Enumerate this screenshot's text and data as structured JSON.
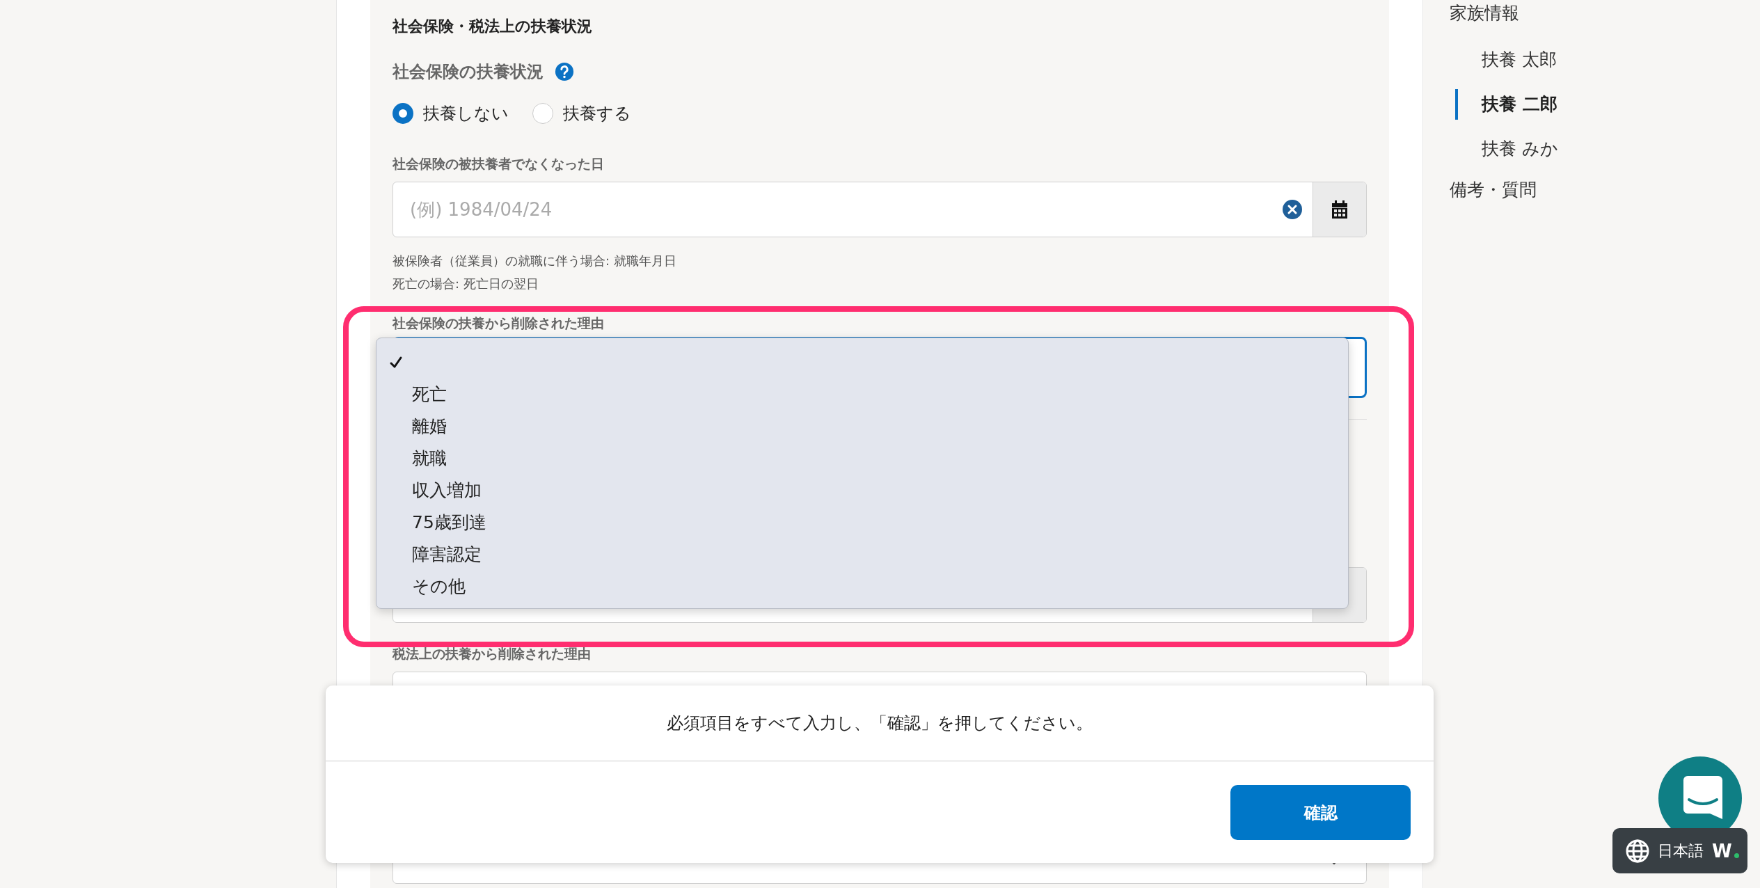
{
  "section_title": "社会保険・税法上の扶養状況",
  "social_insurance": {
    "label": "社会保険の扶養状況",
    "options": [
      {
        "label": "扶養しない",
        "selected": true
      },
      {
        "label": "扶養する",
        "selected": false
      }
    ]
  },
  "loss_date": {
    "label": "社会保険の被扶養者でなくなった日",
    "placeholder": "(例) 1984/04/24",
    "notes": [
      "被保険者（従業員）の就職に伴う場合: 就職年月日",
      "死亡の場合: 死亡日の翌日"
    ]
  },
  "removal_reason": {
    "label": "社会保険の扶養から削除された理由",
    "dropdown": {
      "blank_selected": true,
      "options": [
        {
          "label": "死亡",
          "selected": false
        },
        {
          "label": "離婚",
          "selected": false
        },
        {
          "label": "就職",
          "selected": false
        },
        {
          "label": "収入増加",
          "selected": false
        },
        {
          "label": "75歳到達",
          "selected": false
        },
        {
          "label": "障害認定",
          "selected": false
        },
        {
          "label": "その他",
          "selected": false
        }
      ]
    }
  },
  "tax_removal_reason": {
    "label": "税法上の扶養から削除された理由"
  },
  "footer": {
    "message": "必須項目をすべて入力し、「確認」を押してください。",
    "button": "確認"
  },
  "sidebar": {
    "items": [
      {
        "label": "家族情報",
        "selected": false,
        "children": [
          {
            "label": "扶養 太郎",
            "selected": false
          },
          {
            "label": "扶養 二郎",
            "selected": true
          },
          {
            "label": "扶養 みか",
            "selected": false
          }
        ]
      },
      {
        "label": "備考・質問",
        "selected": false
      }
    ]
  },
  "language": {
    "label": "日本語",
    "logo": "W"
  }
}
